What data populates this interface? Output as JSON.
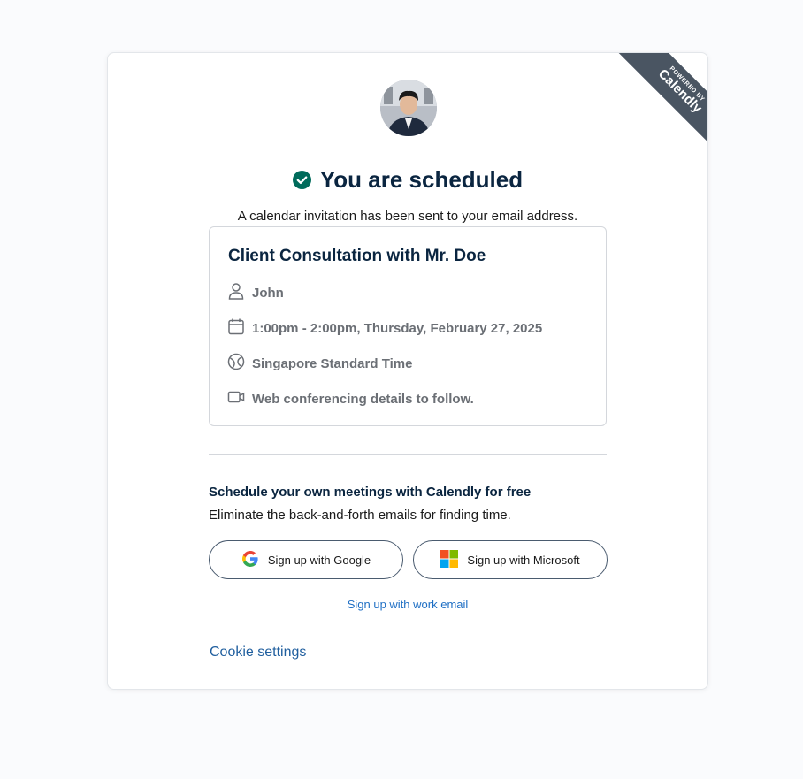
{
  "ribbon": {
    "powered_by": "POWERED BY",
    "brand": "Calendly"
  },
  "header": {
    "title": "You are scheduled",
    "subtitle": "A calendar invitation has been sent to your email address."
  },
  "event": {
    "title": "Client Consultation with Mr. Doe",
    "host": "John",
    "datetime": "1:00pm - 2:00pm, Thursday, February 27, 2025",
    "timezone": "Singapore Standard Time",
    "location": "Web conferencing details to follow."
  },
  "promo": {
    "title": "Schedule your own meetings with Calendly for free",
    "text": "Eliminate the back-and-forth emails for finding time.",
    "google_label": "Sign up with Google",
    "microsoft_label": "Sign up with Microsoft",
    "work_email_label": "Sign up with work email"
  },
  "footer": {
    "cookie_label": "Cookie settings"
  },
  "colors": {
    "accent": "#0a2540",
    "success": "#006b5b",
    "link": "#1f6fc4",
    "ribbon": "#4a5562"
  },
  "icons": [
    "check-circle-icon",
    "person-icon",
    "calendar-icon",
    "globe-icon",
    "video-icon",
    "google-icon",
    "microsoft-icon"
  ]
}
